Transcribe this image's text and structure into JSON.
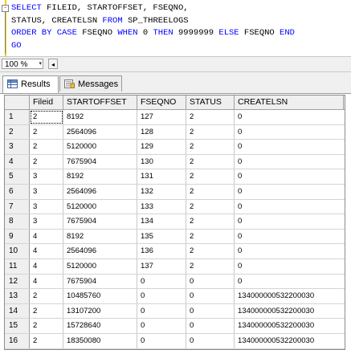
{
  "editor": {
    "line1": {
      "kw": "SELECT",
      "rest": " FILEID, STARTOFFSET, FSEQNO,"
    },
    "line2": {
      "rest": "STATUS, CREATELSN ",
      "kw": "FROM",
      "rest2": " SP_THREELOGS"
    },
    "line3": {
      "kw1": "ORDER BY CASE",
      "id1": " FSEQNO ",
      "kw2": "WHEN",
      "id2": " 0 ",
      "kw3": "THEN",
      "id3": " 9999999 ",
      "kw4": "ELSE",
      "id4": " FSEQNO ",
      "kw5": "END"
    },
    "line4": {
      "kw": "GO"
    },
    "collapse_mark": "−"
  },
  "zoom": {
    "value": "100 %",
    "arrow": "▾",
    "scroll_left": "◂"
  },
  "tabs": [
    {
      "label": "Results",
      "icon": "grid-icon",
      "active": true
    },
    {
      "label": "Messages",
      "icon": "messages-icon",
      "active": false
    }
  ],
  "grid": {
    "columns": [
      "Fileid",
      "STARTOFFSET",
      "FSEQNO",
      "STATUS",
      "CREATELSN"
    ],
    "rows": [
      [
        "1",
        "2",
        "8192",
        "127",
        "2",
        "0"
      ],
      [
        "2",
        "2",
        "2564096",
        "128",
        "2",
        "0"
      ],
      [
        "3",
        "2",
        "5120000",
        "129",
        "2",
        "0"
      ],
      [
        "4",
        "2",
        "7675904",
        "130",
        "2",
        "0"
      ],
      [
        "5",
        "3",
        "8192",
        "131",
        "2",
        "0"
      ],
      [
        "6",
        "3",
        "2564096",
        "132",
        "2",
        "0"
      ],
      [
        "7",
        "3",
        "5120000",
        "133",
        "2",
        "0"
      ],
      [
        "8",
        "3",
        "7675904",
        "134",
        "2",
        "0"
      ],
      [
        "9",
        "4",
        "8192",
        "135",
        "2",
        "0"
      ],
      [
        "10",
        "4",
        "2564096",
        "136",
        "2",
        "0"
      ],
      [
        "11",
        "4",
        "5120000",
        "137",
        "2",
        "0"
      ],
      [
        "12",
        "4",
        "7675904",
        "0",
        "0",
        "0"
      ],
      [
        "13",
        "2",
        "10485760",
        "0",
        "0",
        "134000000532200030"
      ],
      [
        "14",
        "2",
        "13107200",
        "0",
        "0",
        "134000000532200030"
      ],
      [
        "15",
        "2",
        "15728640",
        "0",
        "0",
        "134000000532200030"
      ],
      [
        "16",
        "2",
        "18350080",
        "0",
        "0",
        "134000000532200030"
      ]
    ]
  },
  "colors": {
    "keyword": "#0000ff",
    "function": "#ff00ff",
    "gutter_change": "#f0d000"
  }
}
